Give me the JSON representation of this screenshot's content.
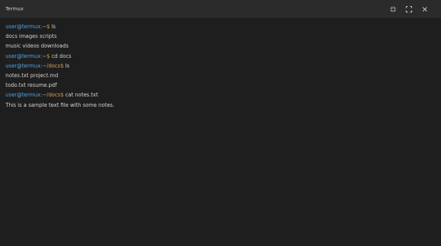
{
  "window": {
    "title": "Termux",
    "controls": {
      "collapse_icon": "collapse-icon",
      "fullscreen_icon": "fullscreen-icon",
      "close_icon": "close-icon"
    }
  },
  "colors": {
    "background": "#1e1e1e",
    "titlebar": "#2b2b2b",
    "user": "#4fa6e8",
    "path": "#d9a05a",
    "text": "#d4d4d4"
  },
  "terminal": {
    "lines": [
      {
        "type": "prompt",
        "user": "user@termux:",
        "path": "~$",
        "cmd": " ls"
      },
      {
        "type": "output",
        "text": "docs images scripts"
      },
      {
        "type": "output",
        "text": "music videos downloads"
      },
      {
        "type": "prompt",
        "user": "user@termux:",
        "path": "~$",
        "cmd": " cd docs"
      },
      {
        "type": "prompt",
        "user": "user@termux:",
        "path": "~/docs$",
        "cmd": " ls"
      },
      {
        "type": "output",
        "text": "notes.txt project.md"
      },
      {
        "type": "output",
        "text": "todo.txt resume.pdf"
      },
      {
        "type": "prompt",
        "user": "user@termux:",
        "path": "~/docs$",
        "cmd": " cat notes.txt"
      },
      {
        "type": "output",
        "text": "This is a sample text file with some notes."
      }
    ]
  }
}
